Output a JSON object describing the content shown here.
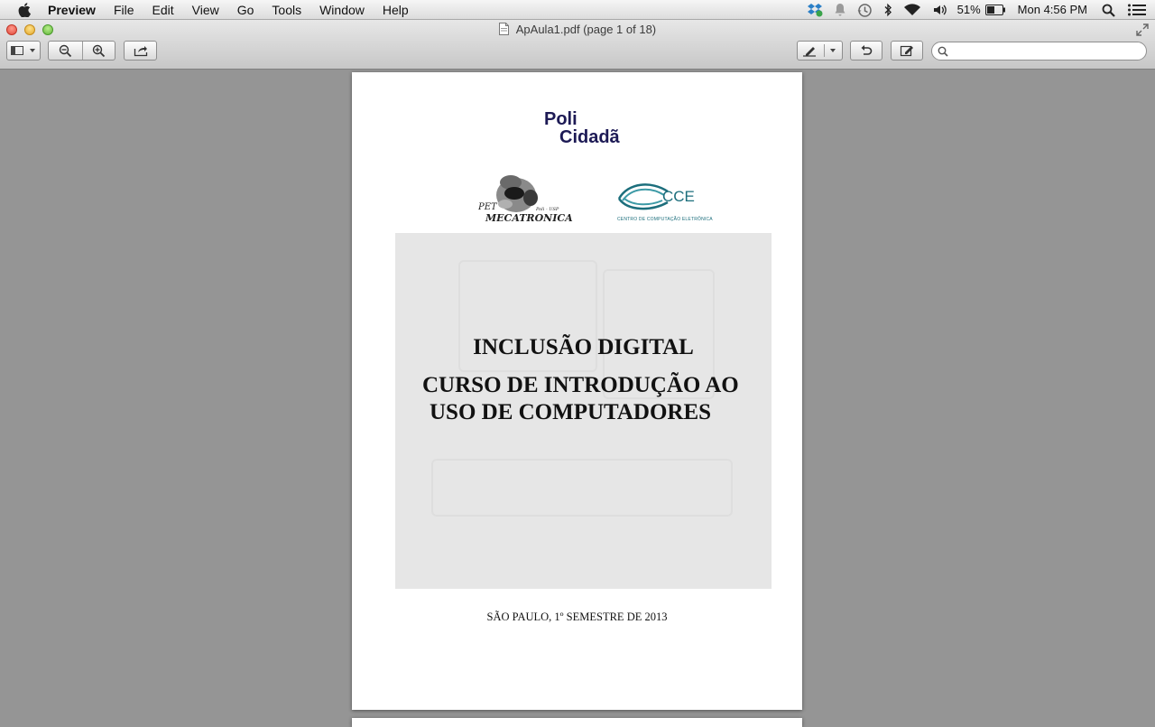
{
  "menubar": {
    "app_name": "Preview",
    "items": [
      "File",
      "Edit",
      "View",
      "Go",
      "Tools",
      "Window",
      "Help"
    ],
    "battery_percent": "51%",
    "clock": "Mon 4:56 PM",
    "status_icons": [
      "dropbox-icon",
      "notification-icon",
      "time-machine-icon",
      "bluetooth-icon",
      "wifi-icon",
      "volume-icon",
      "battery-icon",
      "spotlight-icon",
      "notification-center-icon"
    ]
  },
  "window": {
    "title": "ApAula1.pdf (page 1 of 18)",
    "toolbar": {
      "buttons": [
        "sidebar-view-menu",
        "zoom-out",
        "zoom-in",
        "share",
        "annotate",
        "rotate",
        "edit"
      ],
      "search_value": "",
      "search_placeholder": ""
    }
  },
  "document": {
    "logo_poli_line1": "Poli",
    "logo_poli_line2": "Cidadã",
    "logo_pet_line1": "PET",
    "logo_pet_line2": "MECATRONICA",
    "logo_pet_small": "Poli - USP",
    "logo_cce": "CCE",
    "logo_cce_sub": "CENTRO DE COMPUTAÇÃO ELETRÔNICA",
    "title_line1": "INCLUSÃO DIGITAL",
    "title_line2": "CURSO DE INTRODUÇÃO AO",
    "title_line3": "USO DE COMPUTADORES",
    "footer": "SÃO PAULO, 1º SEMESTRE DE 2013"
  },
  "colors": {
    "desktop_gray": "#959595",
    "poli_navy": "#1d1a55",
    "cce_teal": "#1c6e7c"
  }
}
